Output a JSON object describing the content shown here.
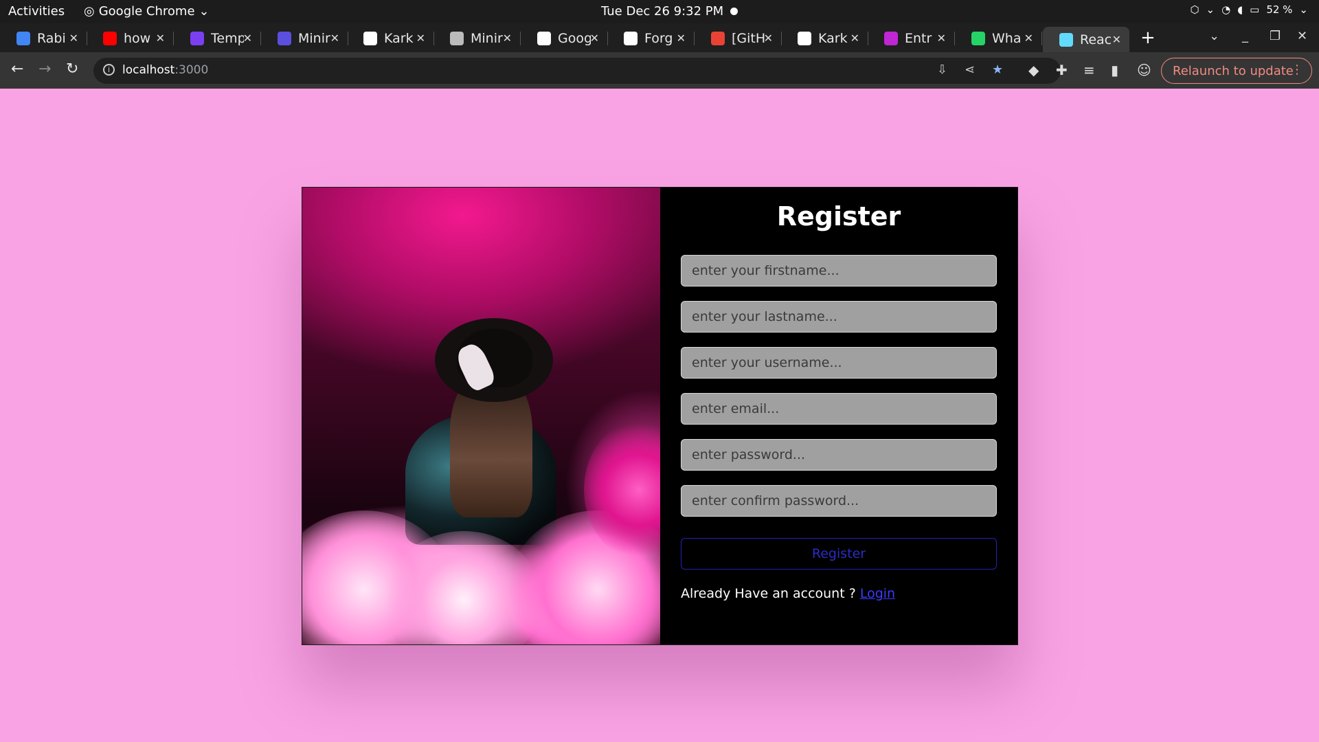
{
  "system": {
    "activities": "Activities",
    "app_name": "Google Chrome",
    "clock": "Tue Dec 26   9:32 PM",
    "battery": "52 %"
  },
  "tabs": [
    {
      "title": "Rabi",
      "icon": "docs-icon",
      "color": "#4285f4"
    },
    {
      "title": "how",
      "icon": "youtube-icon",
      "color": "#ff0000"
    },
    {
      "title": "Temp",
      "icon": "canva-icon",
      "color": "#7b3ff2"
    },
    {
      "title": "Minir",
      "icon": "app-icon",
      "color": "#5b4fe0"
    },
    {
      "title": "Kark",
      "icon": "github-icon",
      "color": "#ffffff"
    },
    {
      "title": "Minir",
      "icon": "globe-icon",
      "color": "#bbbbbb"
    },
    {
      "title": "Goog",
      "icon": "google-icon",
      "color": "#ffffff"
    },
    {
      "title": "Forg",
      "icon": "github-icon",
      "color": "#ffffff"
    },
    {
      "title": "[GitH",
      "icon": "gmail-icon",
      "color": "#ea4335"
    },
    {
      "title": "Kark",
      "icon": "github-icon",
      "color": "#ffffff"
    },
    {
      "title": "Entr",
      "icon": "app-icon",
      "color": "#c026d3"
    },
    {
      "title": "Wha",
      "icon": "whatsapp-icon",
      "color": "#25d366"
    },
    {
      "title": "Reac",
      "icon": "react-icon",
      "color": "#61dafb"
    }
  ],
  "address": {
    "host": "localhost",
    "port": ":3000"
  },
  "relaunch_label": "Relaunch to update",
  "form": {
    "title": "Register",
    "fields": [
      {
        "placeholder": "enter your firstname..."
      },
      {
        "placeholder": "enter your lastname..."
      },
      {
        "placeholder": "enter your username..."
      },
      {
        "placeholder": "enter email..."
      },
      {
        "placeholder": "enter password..."
      },
      {
        "placeholder": "enter confirm password..."
      }
    ],
    "button_label": "Register",
    "already_text": "Already Have an account ?",
    "login_link": "Login"
  },
  "colors": {
    "page_bg": "#f9a3e4",
    "card_bg": "#000000",
    "field_bg": "#a0a0a0",
    "button_border": "#2222bb",
    "link": "#3b3bff",
    "relaunch": "#f28b82"
  }
}
